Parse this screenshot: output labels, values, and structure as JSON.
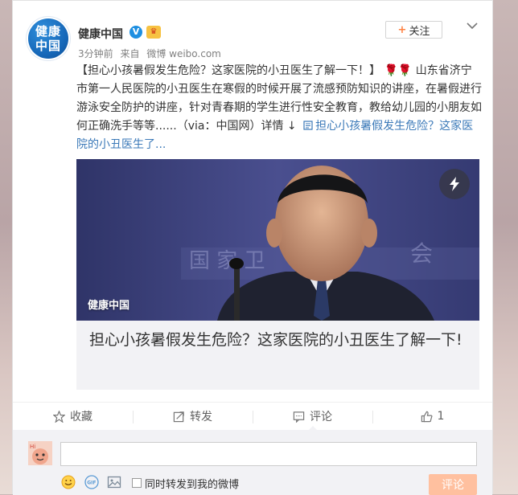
{
  "post": {
    "author": "健康中国",
    "avatar_text": [
      "健康",
      "中国"
    ],
    "follow_label": "关注",
    "time": "3分钟前",
    "from_label": "来自",
    "source": "微博 weibo.com",
    "text_title": "【担心小孩暑假发生危险？这家医院的小丑医生了解一下！】",
    "text_body": "山东省济宁市第一人民医院的小丑医生在寒假的时候开展了流感预防知识的讲座，在暑假进行游泳安全防护的讲座，针对青春期的学生进行性安全教育，教给幼儿园的小朋友如何正确洗手等等......（via：中国网）详情",
    "detail_arrow": "↓",
    "link_text": "担心小孩暑假发生危险？这家医院的小丑医生了..."
  },
  "media": {
    "watermark": "健康中国",
    "title": "担心小孩暑假发生危险？这家医院的小丑医生了解一下!"
  },
  "actions": {
    "favorite_label": "收藏",
    "repost_label": "转发",
    "comment_label": "评论",
    "like_count": "1"
  },
  "comment_box": {
    "value": "",
    "repost_option": "同时转发到我的微博",
    "submit_label": "评论"
  },
  "colors": {
    "link": "#3b79b8",
    "accent": "#ff8140",
    "submit_disabled": "#ffc09f"
  }
}
